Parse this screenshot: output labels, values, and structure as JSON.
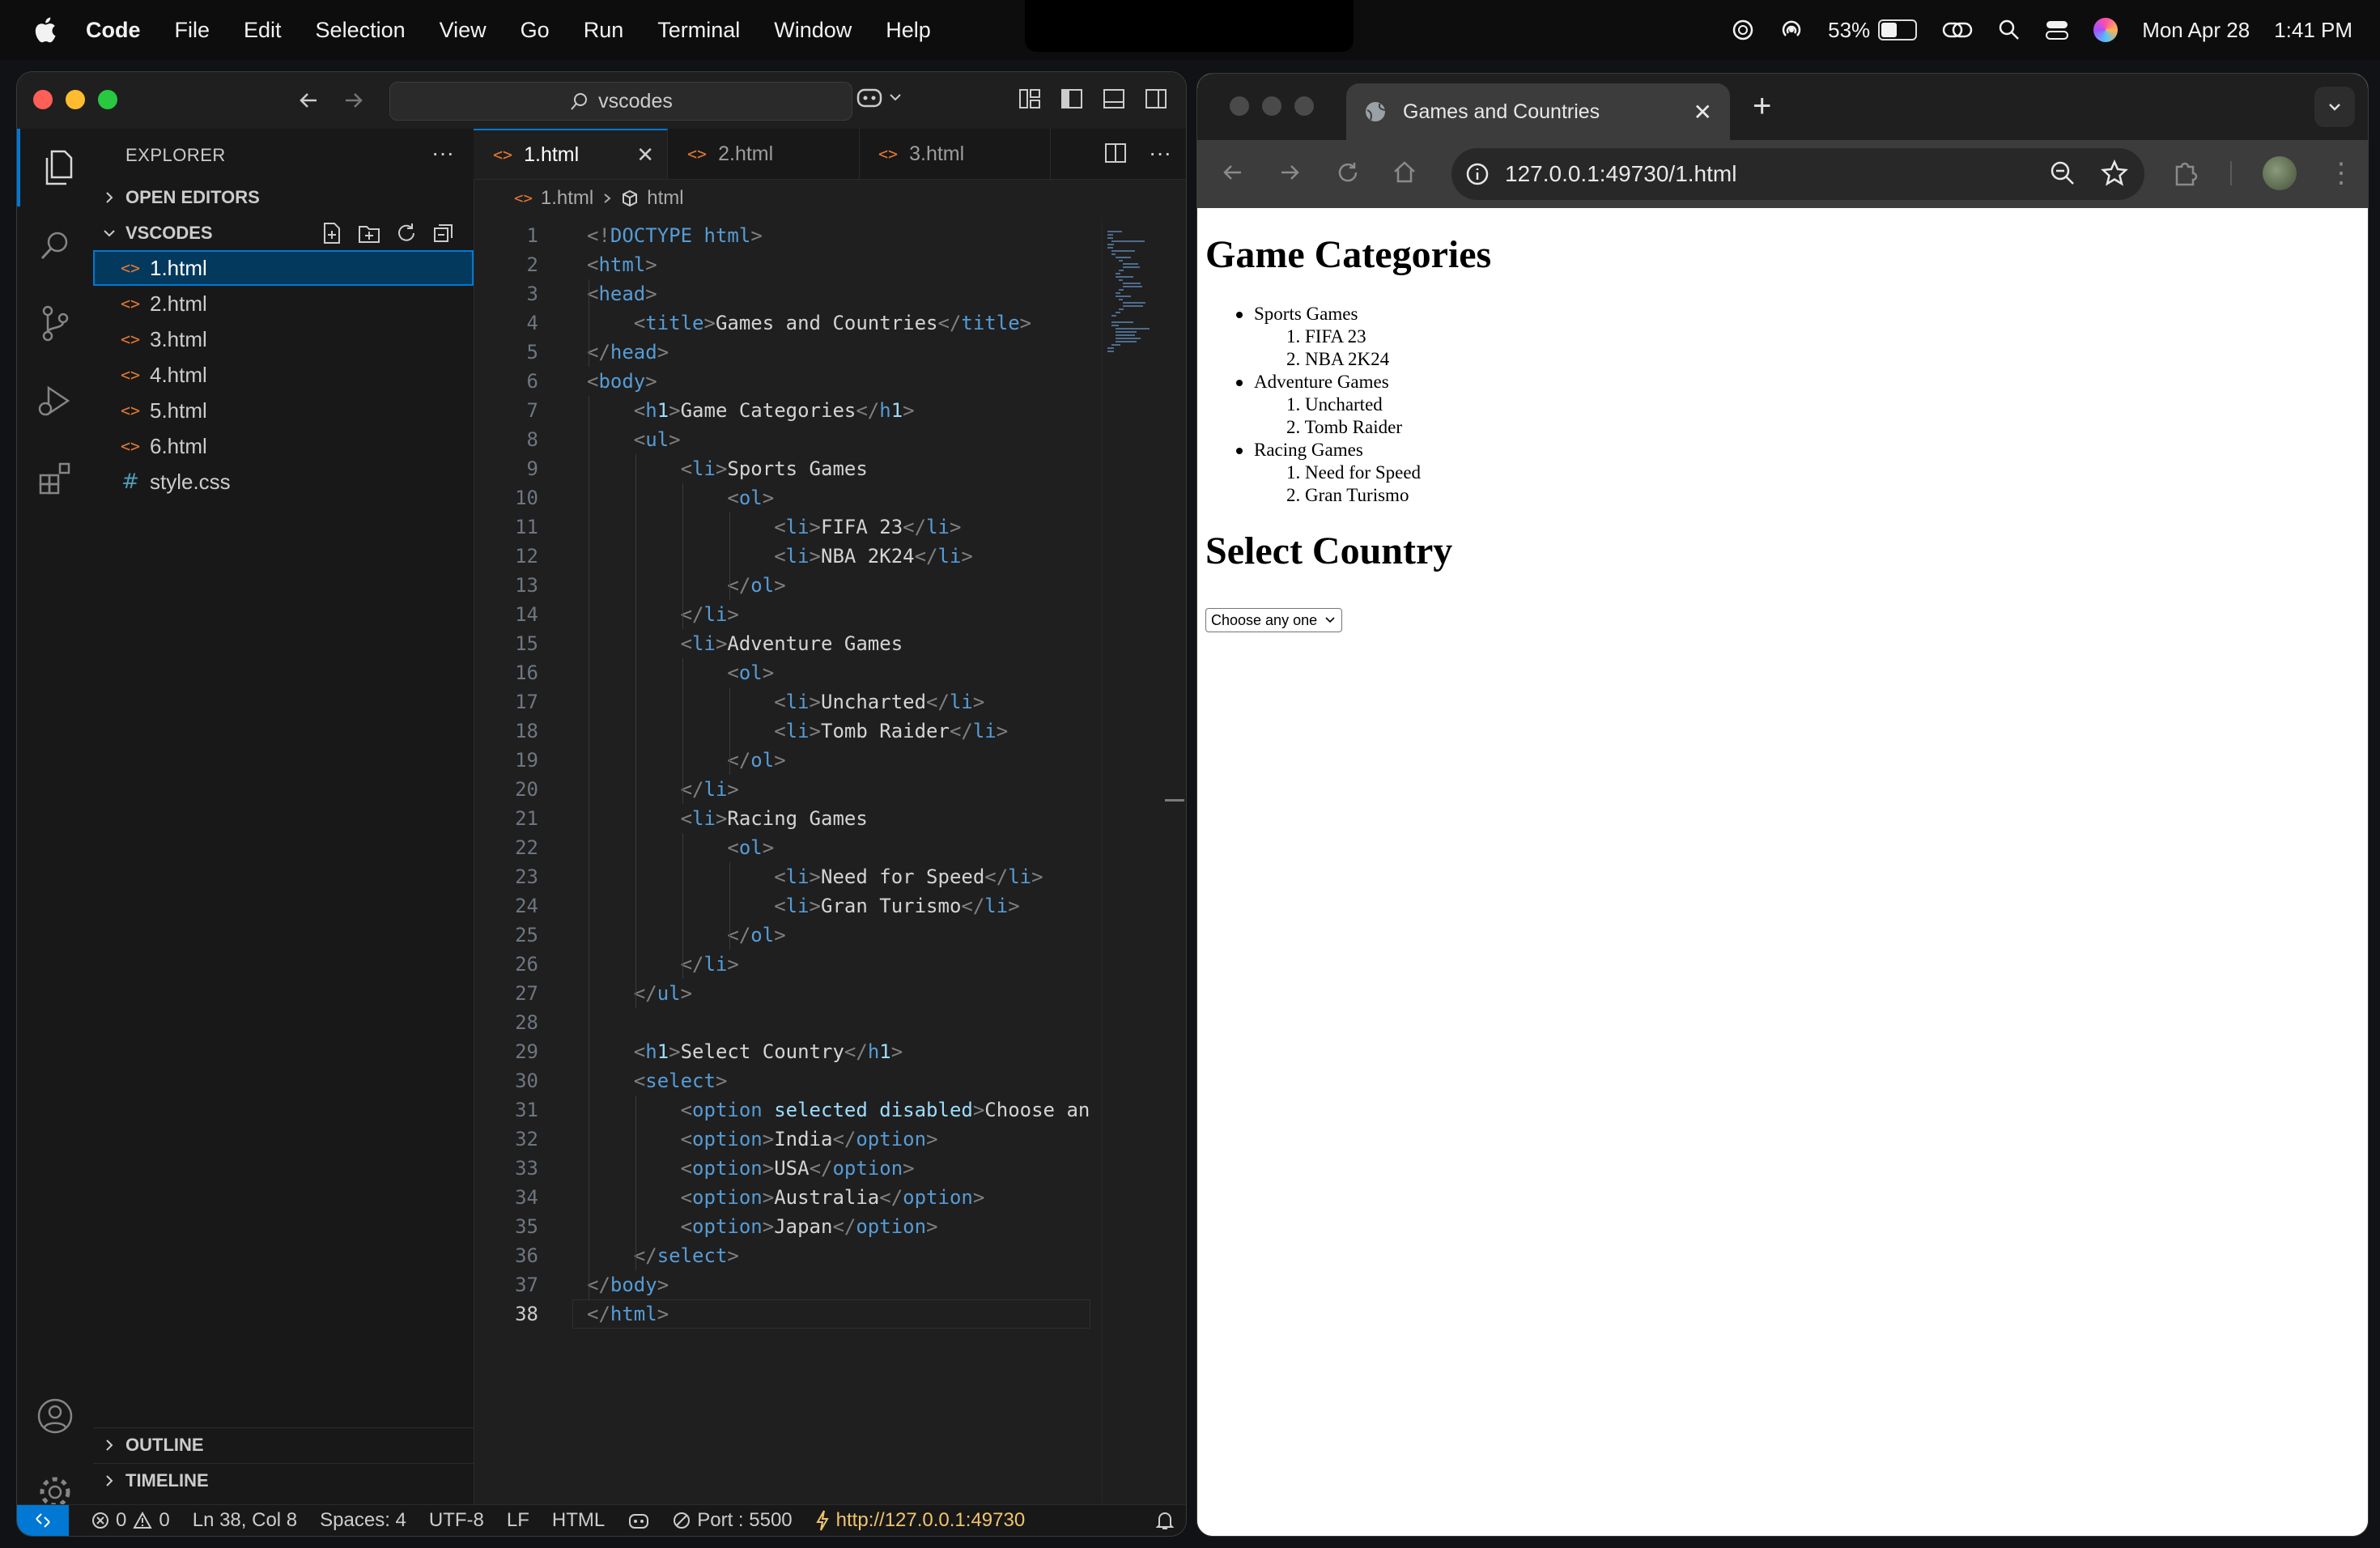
{
  "menubar": {
    "app": "Code",
    "items": [
      "File",
      "Edit",
      "Selection",
      "View",
      "Go",
      "Run",
      "Terminal",
      "Window",
      "Help"
    ],
    "battery_pct": "53%",
    "battery_level": 0.53,
    "date": "Mon Apr 28",
    "time": "1:41 PM"
  },
  "vscode": {
    "search": "vscodes",
    "explorer_title": "EXPLORER",
    "open_editors": "OPEN EDITORS",
    "folder": "VSCODES",
    "files": [
      {
        "name": "1.html",
        "type": "html"
      },
      {
        "name": "2.html",
        "type": "html"
      },
      {
        "name": "3.html",
        "type": "html"
      },
      {
        "name": "4.html",
        "type": "html"
      },
      {
        "name": "5.html",
        "type": "html"
      },
      {
        "name": "6.html",
        "type": "html"
      },
      {
        "name": "style.css",
        "type": "css"
      }
    ],
    "file_icon_html": "<>",
    "file_icon_css": "#",
    "tabs": [
      {
        "label": "1.html",
        "active": true
      },
      {
        "label": "2.html",
        "active": false
      },
      {
        "label": "3.html",
        "active": false
      }
    ],
    "breadcrumb": {
      "file": "1.html",
      "symbol": "html"
    },
    "outline": "OUTLINE",
    "timeline": "TIMELINE",
    "code": [
      "<!DOCTYPE html>",
      "<html>",
      "<head>",
      "    <title>Games and Countries</title>",
      "</head>",
      "<body>",
      "    <h1>Game Categories</h1>",
      "    <ul>",
      "        <li>Sports Games",
      "            <ol>",
      "                <li>FIFA 23</li>",
      "                <li>NBA 2K24</li>",
      "            </ol>",
      "        </li>",
      "        <li>Adventure Games",
      "            <ol>",
      "                <li>Uncharted</li>",
      "                <li>Tomb Raider</li>",
      "            </ol>",
      "        </li>",
      "        <li>Racing Games",
      "            <ol>",
      "                <li>Need for Speed</li>",
      "                <li>Gran Turismo</li>",
      "            </ol>",
      "        </li>",
      "    </ul>",
      "",
      "    <h1>Select Country</h1>",
      "    <select>",
      "        <option selected disabled>Choose an",
      "        <option>India</option>",
      "        <option>USA</option>",
      "        <option>Australia</option>",
      "        <option>Japan</option>",
      "    </select>",
      "</body>",
      "</html>"
    ],
    "current_line": 38,
    "status": {
      "errors": "0",
      "warnings": "0",
      "position": "Ln 38, Col 8",
      "spaces": "Spaces: 4",
      "encoding": "UTF-8",
      "eol": "LF",
      "language": "HTML",
      "port": "Port : 5500",
      "live_url": "http://127.0.0.1:49730"
    }
  },
  "chrome": {
    "tab_title": "Games and Countries",
    "url": "127.0.0.1:49730/1.html",
    "page": {
      "h1_games": "Game Categories",
      "categories": [
        {
          "name": "Sports Games",
          "items": [
            "1. FIFA 23",
            "2. NBA 2K24"
          ]
        },
        {
          "name": "Adventure Games",
          "items": [
            "1. Uncharted",
            "2. Tomb Raider"
          ]
        },
        {
          "name": "Racing Games",
          "items": [
            "1. Need for Speed",
            "2. Gran Turismo"
          ]
        }
      ],
      "h1_country": "Select Country",
      "select_value": "Choose any one"
    }
  }
}
